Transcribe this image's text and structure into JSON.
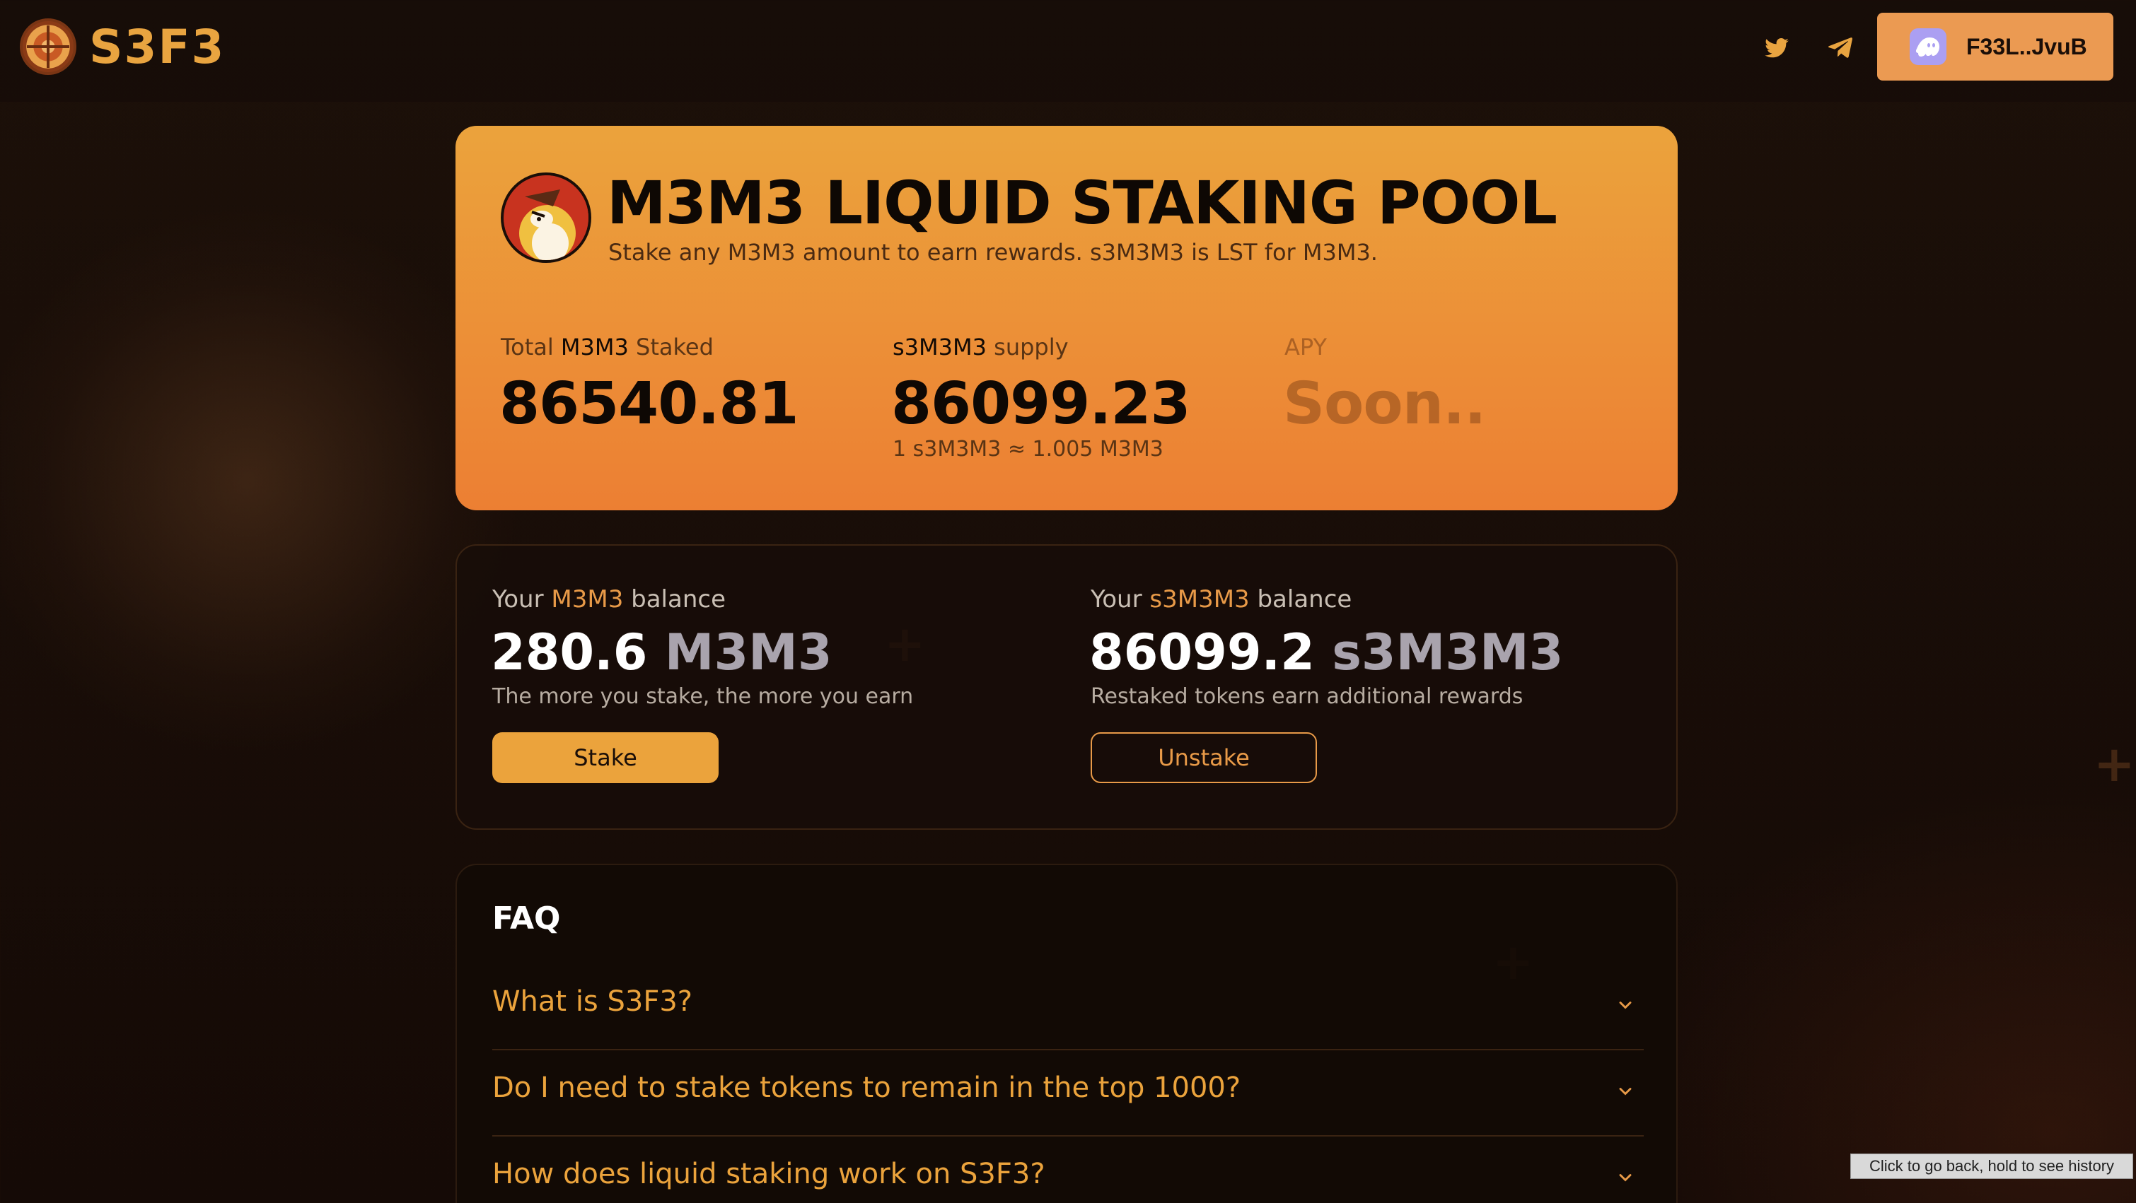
{
  "brand": {
    "name": "S3F3"
  },
  "header": {
    "social": [
      "twitter-icon",
      "telegram-icon"
    ],
    "wallet_label": "F33L..JvuB"
  },
  "hero": {
    "title": "M3M3 LIQUID STAKING POOL",
    "subtitle": "Stake any M3M3 amount to earn rewards. s3M3M3 is LST for M3M3.",
    "stats": {
      "total_label_prefix": "Total ",
      "total_label_token": "M3M3",
      "total_label_suffix": " Staked",
      "total_value": "86540.81",
      "supply_label_token": "s3M3M3",
      "supply_label_suffix": " supply",
      "supply_value": "86099.23",
      "supply_note": "1 s3M3M3 ≈ 1.005 M3M3",
      "apy_label": "APY",
      "apy_value": "Soon.."
    }
  },
  "balances": {
    "left": {
      "label_prefix": "Your ",
      "label_token": "M3M3",
      "label_suffix": " balance",
      "amount": "280.6",
      "unit": "M3M3",
      "description": "The more you stake, the more you earn",
      "button": "Stake"
    },
    "right": {
      "label_prefix": "Your ",
      "label_token": "s3M3M3",
      "label_suffix": " balance",
      "amount": "86099.2",
      "unit": "s3M3M3",
      "description": "Restaked tokens earn additional rewards",
      "button": "Unstake"
    }
  },
  "faq": {
    "title": "FAQ",
    "items": [
      "What is S3F3?",
      "Do I need to stake tokens to remain in the top 1000?",
      "How does liquid staking work on S3F3?"
    ]
  },
  "tooltip": "Click to go back, hold to see history",
  "colors": {
    "accent": "#eba33c",
    "accent_deep": "#ec7f33",
    "background": "#1a0e08"
  }
}
